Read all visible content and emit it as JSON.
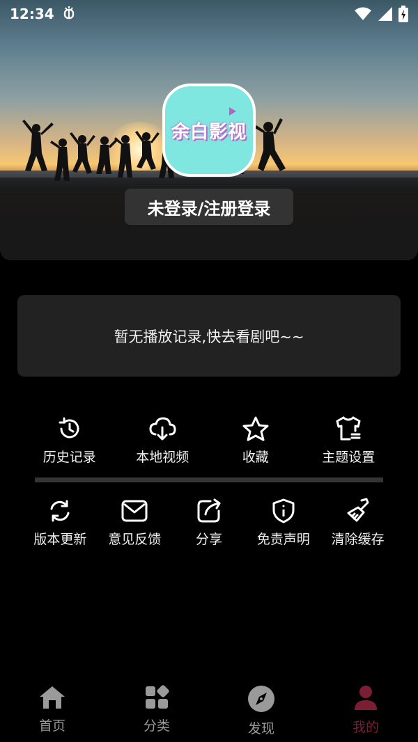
{
  "status_bar": {
    "time": "12:34",
    "notification_icon": "bug-icon",
    "wifi_icon": "wifi-icon",
    "signal_icon": "signal-icon",
    "battery_icon": "battery-charging-icon"
  },
  "profile": {
    "app_logo_text": "余白影视",
    "login_label": "未登录/注册登录"
  },
  "history": {
    "empty_text": "暂无播放记录,快去看剧吧~~"
  },
  "quick_actions": [
    {
      "label": "历史记录",
      "icon": "history-icon"
    },
    {
      "label": "本地视频",
      "icon": "cloud-download-icon"
    },
    {
      "label": "收藏",
      "icon": "star-icon"
    },
    {
      "label": "主题设置",
      "icon": "shirt-icon"
    }
  ],
  "settings_actions": [
    {
      "label": "版本更新",
      "icon": "refresh-icon"
    },
    {
      "label": "意见反馈",
      "icon": "mail-icon"
    },
    {
      "label": "分享",
      "icon": "share-icon"
    },
    {
      "label": "免责声明",
      "icon": "shield-info-icon"
    },
    {
      "label": "清除缓存",
      "icon": "brush-icon"
    }
  ],
  "bottom_nav": [
    {
      "label": "首页",
      "icon": "home-icon",
      "active": false
    },
    {
      "label": "分类",
      "icon": "category-icon",
      "active": false
    },
    {
      "label": "发现",
      "icon": "compass-icon",
      "active": false
    },
    {
      "label": "我的",
      "icon": "user-icon",
      "active": true
    }
  ],
  "colors": {
    "background": "#000000",
    "card": "#222222",
    "inactive_nav": "#9a9a9a",
    "active_nav": "#7a1f33",
    "logo_bg": "#7fe6e0"
  }
}
